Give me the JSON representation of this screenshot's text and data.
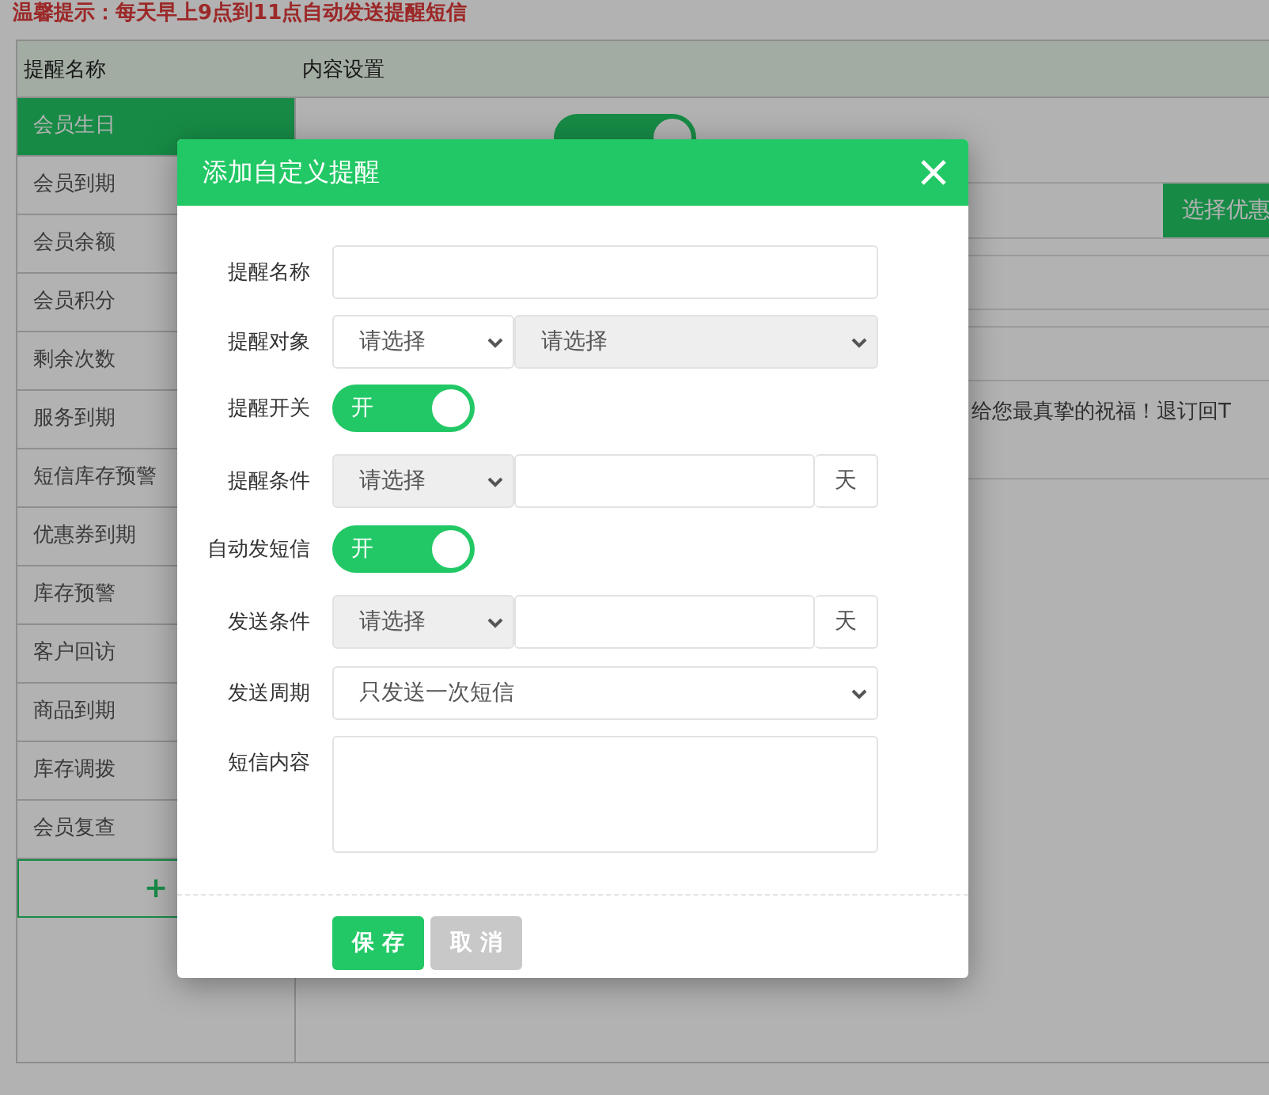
{
  "notice": "温馨提示：每天早上9点到11点自动发送提醒短信",
  "table": {
    "columns": [
      "提醒名称",
      "内容设置"
    ]
  },
  "sidebar": {
    "items": [
      {
        "label": "会员生日",
        "selected": true
      },
      {
        "label": "会员到期",
        "selected": false
      },
      {
        "label": "会员余额",
        "selected": false
      },
      {
        "label": "会员积分",
        "selected": false
      },
      {
        "label": "剩余次数",
        "selected": false
      },
      {
        "label": "服务到期",
        "selected": false
      },
      {
        "label": "短信库存预警",
        "selected": false
      },
      {
        "label": "优惠券到期",
        "selected": false
      },
      {
        "label": "库存预警",
        "selected": false
      },
      {
        "label": "客户回访",
        "selected": false
      },
      {
        "label": "商品到期",
        "selected": false
      },
      {
        "label": "库存调拨",
        "selected": false
      },
      {
        "label": "会员复查",
        "selected": false
      }
    ],
    "add_button": "+"
  },
  "content": {
    "auto_sms_toggle": {
      "on": true
    },
    "coupon_button": "选择优惠",
    "message_preview": "给您最真挚的祝福！退订回T"
  },
  "dialog": {
    "title": "添加自定义提醒",
    "fields": [
      {
        "kind": "text",
        "label": "提醒名称"
      },
      {
        "kind": "select_pair",
        "label": "提醒对象",
        "values": [
          "请选择",
          "请选择"
        ]
      },
      {
        "kind": "toggle",
        "label": "提醒开关",
        "text": "开",
        "on": true
      },
      {
        "kind": "select_days",
        "label": "提醒条件",
        "value": "请选择",
        "unit": "天"
      },
      {
        "kind": "toggle",
        "label": "自动发短信",
        "text": "开",
        "on": true
      },
      {
        "kind": "select_days",
        "label": "发送条件",
        "value": "请选择",
        "unit": "天"
      },
      {
        "kind": "select",
        "label": "发送周期",
        "value": "只发送一次短信"
      },
      {
        "kind": "textarea",
        "label": "短信内容"
      }
    ],
    "buttons": [
      {
        "label": "保 存",
        "kind": "primary"
      },
      {
        "label": "取 消",
        "kind": "secondary"
      }
    ]
  }
}
